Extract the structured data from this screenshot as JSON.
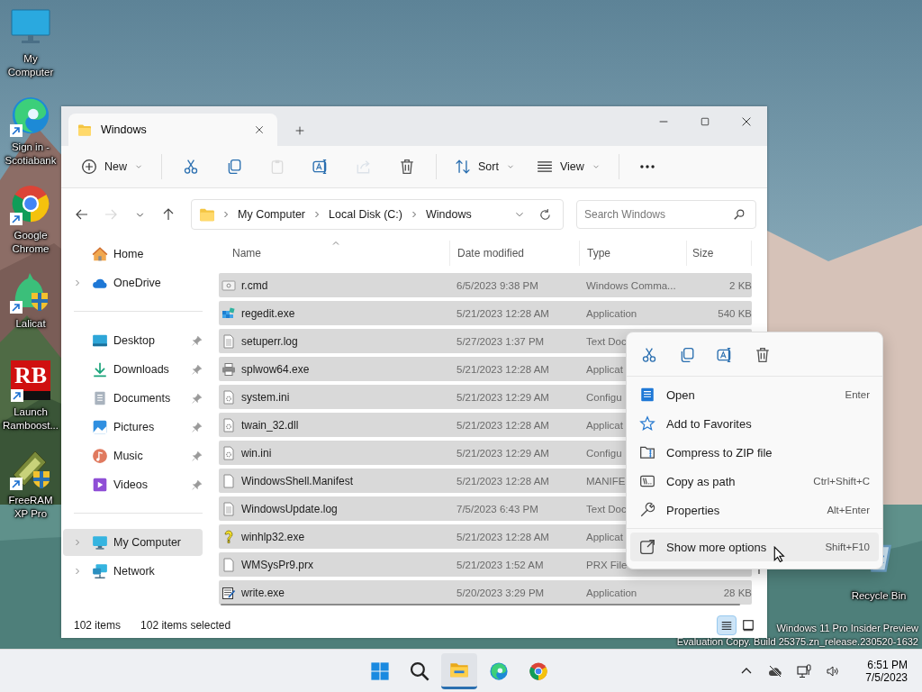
{
  "desktop_icons": [
    {
      "label": "My Computer",
      "kind": "computer",
      "shortcut": false
    },
    {
      "label": "Sign in - Scotiabank",
      "kind": "edge",
      "shortcut": true
    },
    {
      "label": "Google Chrome",
      "kind": "chrome",
      "shortcut": true
    },
    {
      "label": "Lalicat",
      "kind": "lalicat",
      "shortcut": true
    },
    {
      "label": "Launch Ramboost...",
      "kind": "rb",
      "logo_text": "RB",
      "shortcut": true
    },
    {
      "label": "FreeRAM XP Pro",
      "kind": "freeram",
      "shortcut": true
    }
  ],
  "window": {
    "tab": {
      "title": "Windows"
    },
    "toolbar": [
      {
        "kind": "new",
        "label": "New",
        "disabled": false
      },
      {
        "kind": "cut",
        "disabled": false
      },
      {
        "kind": "copy",
        "disabled": false
      },
      {
        "kind": "paste",
        "disabled": true
      },
      {
        "kind": "rename",
        "disabled": false
      },
      {
        "kind": "share",
        "disabled": true
      },
      {
        "kind": "delete",
        "disabled": false
      },
      {
        "kind": "sort",
        "label": "Sort",
        "disabled": false
      },
      {
        "kind": "view",
        "label": "View",
        "disabled": false
      },
      {
        "kind": "more",
        "disabled": false
      }
    ],
    "nav": [
      {
        "kind": "back",
        "disabled": false
      },
      {
        "kind": "forward",
        "disabled": true
      },
      {
        "kind": "recent",
        "disabled": false
      },
      {
        "kind": "up",
        "disabled": false
      }
    ],
    "address": {
      "crumbs": [
        "My Computer",
        "Local Disk (C:)",
        "Windows"
      ]
    },
    "search": {
      "placeholder": "Search Windows"
    },
    "sidebar": {
      "groups": [
        [
          {
            "label": "Home",
            "kind": "home",
            "expandable": false,
            "pinned": false,
            "selected": false
          },
          {
            "label": "OneDrive",
            "kind": "cloud",
            "expandable": true,
            "pinned": false,
            "selected": false
          }
        ],
        [
          {
            "label": "Desktop",
            "kind": "desktop",
            "expandable": false,
            "pinned": true,
            "selected": false
          },
          {
            "label": "Downloads",
            "kind": "downloads",
            "expandable": false,
            "pinned": true,
            "selected": false
          },
          {
            "label": "Documents",
            "kind": "documents",
            "expandable": false,
            "pinned": true,
            "selected": false
          },
          {
            "label": "Pictures",
            "kind": "pictures",
            "expandable": false,
            "pinned": true,
            "selected": false
          },
          {
            "label": "Music",
            "kind": "music",
            "expandable": false,
            "pinned": true,
            "selected": false
          },
          {
            "label": "Videos",
            "kind": "videos",
            "expandable": false,
            "pinned": true,
            "selected": false
          }
        ],
        [
          {
            "label": "My Computer",
            "kind": "computer",
            "expandable": true,
            "pinned": false,
            "selected": true
          },
          {
            "label": "Network",
            "kind": "network",
            "expandable": true,
            "pinned": false,
            "selected": false
          }
        ]
      ]
    },
    "table": {
      "columns": [
        "Name",
        "Date modified",
        "Type",
        "Size"
      ],
      "rows": [
        {
          "name": "r.cmd",
          "kind": "script",
          "date": "6/5/2023 9:38 PM",
          "type": "Windows Comma...",
          "size": "2 KB",
          "selected": true
        },
        {
          "name": "regedit.exe",
          "kind": "regedit",
          "date": "5/21/2023 12:28 AM",
          "type": "Application",
          "size": "540 KB",
          "selected": true
        },
        {
          "name": "setuperr.log",
          "kind": "text",
          "date": "5/27/2023 1:37 PM",
          "type": "Text Doc",
          "selected": true
        },
        {
          "name": "splwow64.exe",
          "kind": "printer",
          "date": "5/21/2023 12:28 AM",
          "type": "Applicat",
          "selected": true
        },
        {
          "name": "system.ini",
          "kind": "config",
          "date": "5/21/2023 12:29 AM",
          "type": "Configu",
          "selected": true
        },
        {
          "name": "twain_32.dll",
          "kind": "config",
          "date": "5/21/2023 12:28 AM",
          "type": "Applicat",
          "selected": true
        },
        {
          "name": "win.ini",
          "kind": "config",
          "date": "5/21/2023 12:29 AM",
          "type": "Configu",
          "selected": true
        },
        {
          "name": "WindowsShell.Manifest",
          "kind": "blank",
          "date": "5/21/2023 12:28 AM",
          "type": "MANIFE",
          "selected": true
        },
        {
          "name": "WindowsUpdate.log",
          "kind": "text",
          "date": "7/5/2023 6:43 PM",
          "type": "Text Doc",
          "selected": true
        },
        {
          "name": "winhlp32.exe",
          "kind": "help",
          "date": "5/21/2023 12:28 AM",
          "type": "Applicat",
          "selected": true
        },
        {
          "name": "WMSysPr9.prx",
          "kind": "blank",
          "date": "5/21/2023 1:52 AM",
          "type": "PRX File",
          "selected": true
        },
        {
          "name": "write.exe",
          "kind": "write",
          "date": "5/20/2023 3:29 PM",
          "type": "Application",
          "size": "28 KB",
          "selected": true
        }
      ]
    },
    "status_bar": {
      "count": "102 items",
      "selection": "102 items selected",
      "views": [
        {
          "kind": "details",
          "selected": true
        },
        {
          "kind": "tiles",
          "selected": false
        }
      ]
    }
  },
  "context_menu": {
    "actions": [
      {
        "kind": "cut"
      },
      {
        "kind": "copy"
      },
      {
        "kind": "rename"
      },
      {
        "kind": "delete"
      }
    ],
    "groups": [
      [
        {
          "label": "Open",
          "kind": "open",
          "shortcut": "Enter",
          "selected": false
        },
        {
          "label": "Add to Favorites",
          "kind": "star",
          "selected": false
        },
        {
          "label": "Compress to ZIP file",
          "kind": "zip",
          "selected": false
        },
        {
          "label": "Copy as path",
          "kind": "path",
          "shortcut": "Ctrl+Shift+C",
          "selected": false
        },
        {
          "label": "Properties",
          "kind": "wrench",
          "shortcut": "Alt+Enter",
          "selected": false
        }
      ],
      [
        {
          "label": "Show more options",
          "kind": "more",
          "shortcut": "Shift+F10",
          "selected": true
        }
      ]
    ]
  },
  "recycle_bin": {
    "label": "Recycle Bin"
  },
  "watermark": [
    "Windows 11 Pro Insider Preview",
    "Evaluation Copy. Build 25375.zn_release.230520-1632"
  ],
  "taskbar": {
    "apps": [
      {
        "kind": "start",
        "active": false
      },
      {
        "kind": "search",
        "active": false
      },
      {
        "kind": "explorer",
        "active": true
      },
      {
        "kind": "edge",
        "active": false
      },
      {
        "kind": "chrome",
        "active": false
      }
    ],
    "tray": [
      {
        "kind": "chevron"
      },
      {
        "kind": "cloud-off"
      },
      {
        "kind": "network"
      },
      {
        "kind": "volume"
      }
    ],
    "time": "6:51 PM",
    "date": "7/5/2023"
  }
}
